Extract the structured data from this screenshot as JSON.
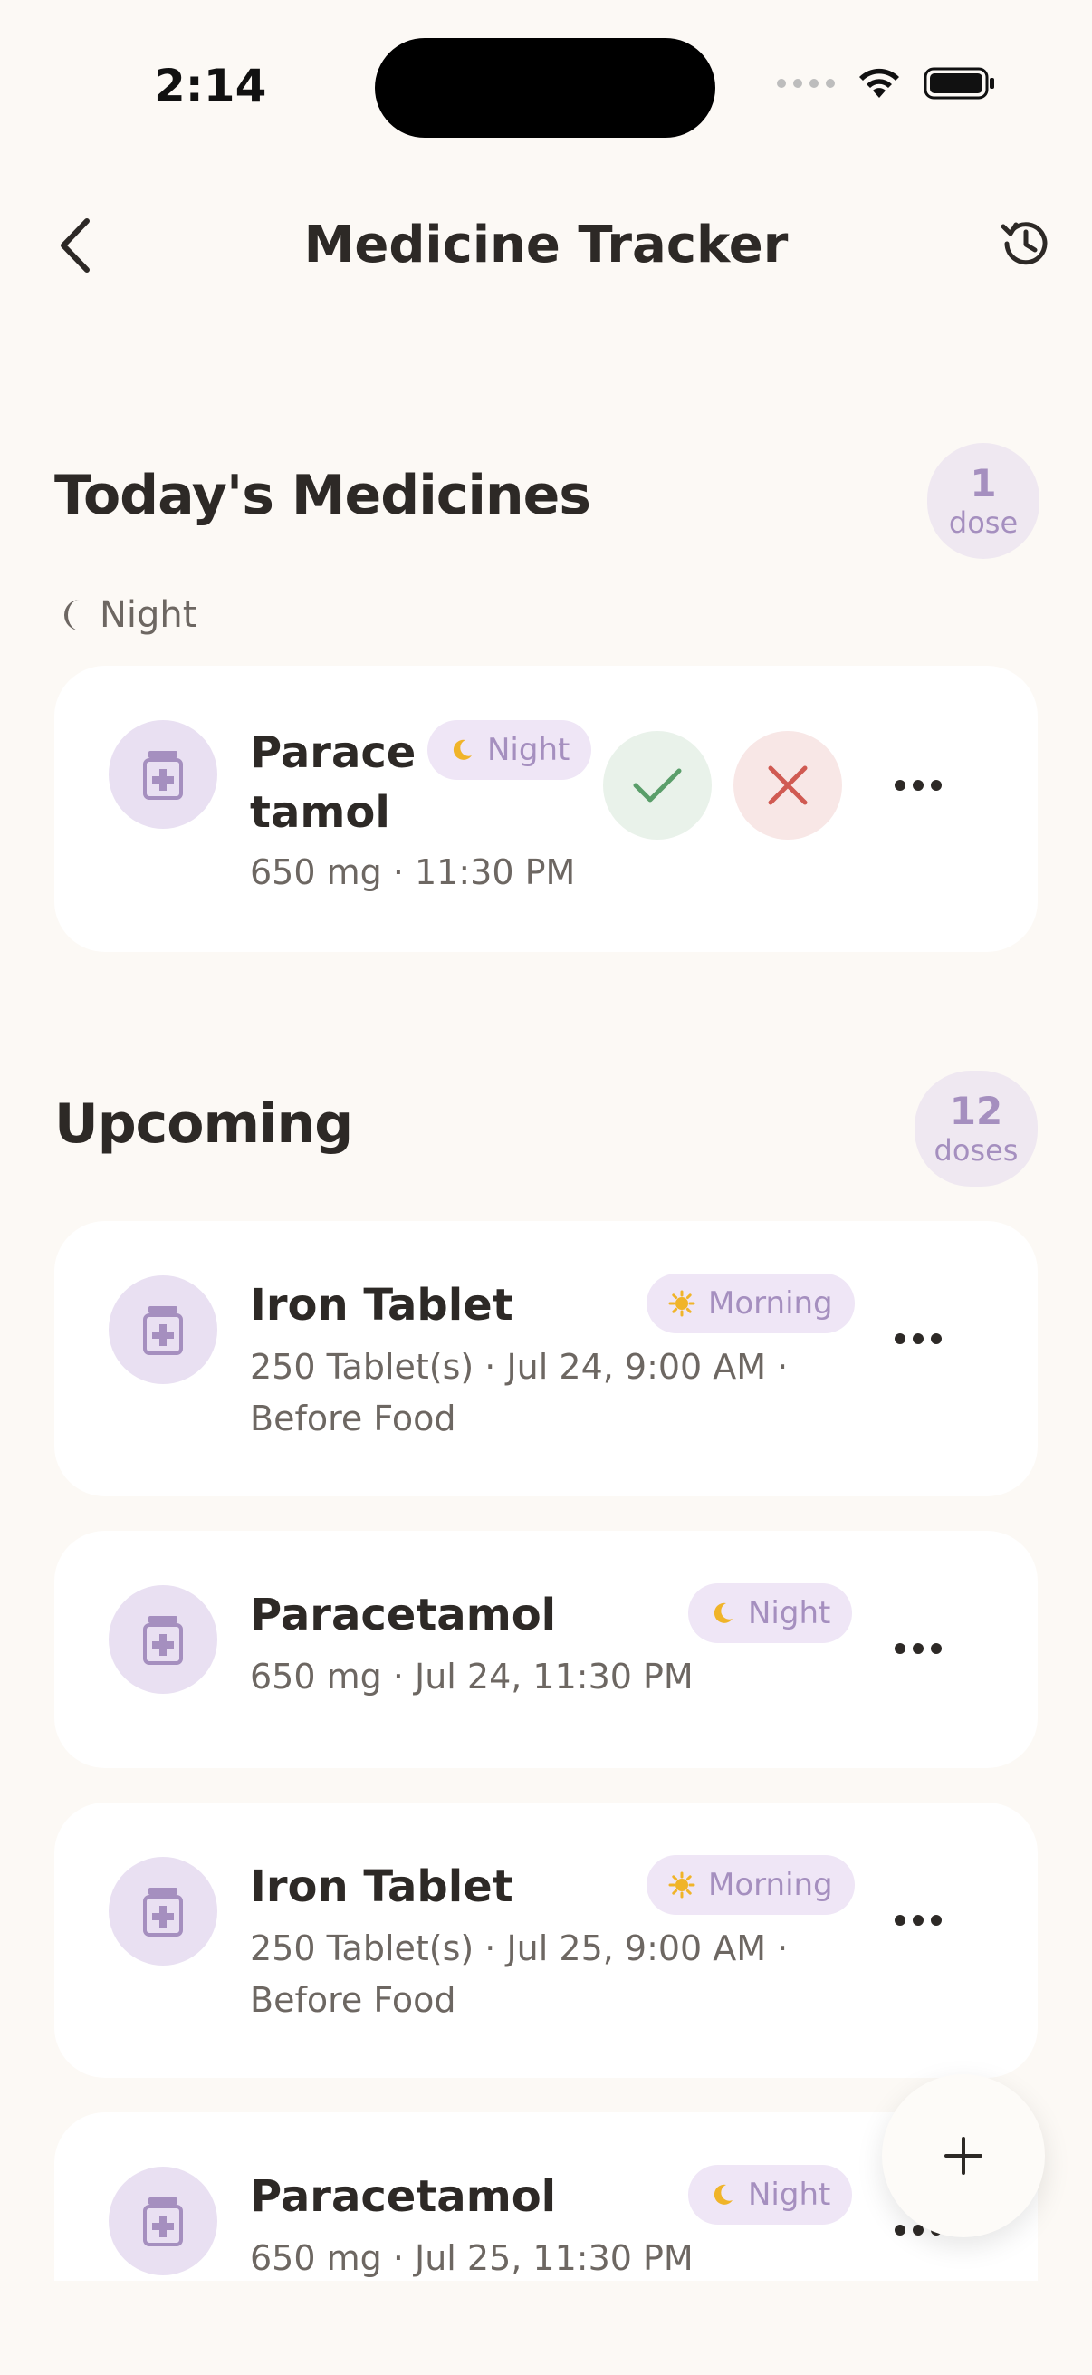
{
  "status_bar": {
    "time": "2:14"
  },
  "header": {
    "title": "Medicine Tracker",
    "back_icon": "chevron-left-icon",
    "history_icon": "history-icon"
  },
  "today": {
    "title": "Today's Medicines",
    "count_number": "1",
    "count_unit": "dose",
    "group_label": "Night",
    "items": [
      {
        "name_line1": "Parace",
        "name_line2": "tamol",
        "detail": "650 mg · 11:30 PM",
        "tag": "Night",
        "tag_icon": "moon-icon"
      }
    ]
  },
  "upcoming": {
    "title": "Upcoming",
    "count_number": "12",
    "count_unit": "doses",
    "items": [
      {
        "name": "Iron Tablet",
        "detail_line1": "250 Tablet(s) · Jul 24, 9:00 AM ·",
        "detail_line2": "Before Food",
        "tag": "Morning",
        "tag_icon": "sun-icon"
      },
      {
        "name": "Paracetamol",
        "detail_line1": "650 mg · Jul 24, 11:30 PM",
        "tag": "Night",
        "tag_icon": "moon-icon"
      },
      {
        "name": "Iron Tablet",
        "detail_line1": "250 Tablet(s) · Jul 25, 9:00 AM ·",
        "detail_line2": "Before Food",
        "tag": "Morning",
        "tag_icon": "sun-icon"
      },
      {
        "name": "Paracetamol",
        "detail_line1": "650 mg · Jul 25, 11:30 PM",
        "tag": "Night",
        "tag_icon": "moon-icon"
      }
    ]
  },
  "colors": {
    "background": "#fcf9f5",
    "accent_purple": "#a58fbf",
    "take_green": "#5a9e6a",
    "skip_red": "#d05a52"
  }
}
